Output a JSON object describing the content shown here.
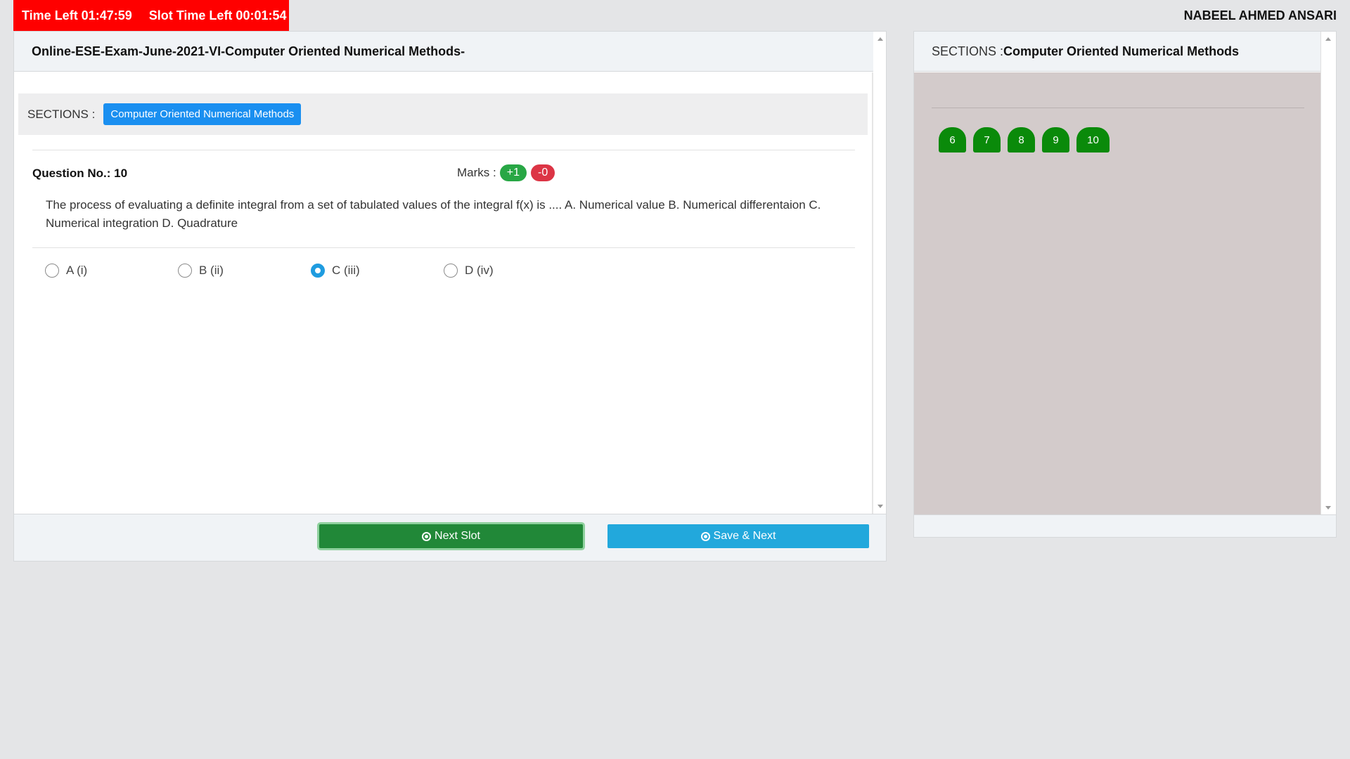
{
  "timer": {
    "time_left": "Time Left 01:47:59",
    "slot_time_left": "Slot Time Left 00:01:54"
  },
  "user": {
    "name": "NABEEL AHMED ANSARI"
  },
  "exam": {
    "title": "Online-ESE-Exam-June-2021-VI-Computer Oriented Numerical Methods-",
    "sections_label": "SECTIONS :",
    "section_name": "Computer Oriented Numerical Methods"
  },
  "question": {
    "number_label": "Question No.: 10",
    "marks_label": "Marks :",
    "marks_positive": "+1",
    "marks_negative": "-0",
    "text": "The process of evaluating a definite integral from a set of tabulated values of the integral f(x) is .... A. Numerical value B. Numerical differentaion C. Numerical integration D. Quadrature",
    "options": [
      {
        "label": "A (i)",
        "checked": false
      },
      {
        "label": "B (ii)",
        "checked": false
      },
      {
        "label": "C (iii)",
        "checked": true
      },
      {
        "label": "D (iv)",
        "checked": false
      }
    ]
  },
  "footer": {
    "next_slot": "Next Slot",
    "save_next": "Save & Next"
  },
  "side": {
    "sections_prefix": "SECTIONS :",
    "section_name": "Computer Oriented Numerical Methods",
    "question_buttons": [
      "6",
      "7",
      "8",
      "9",
      "10"
    ]
  },
  "colors": {
    "timer_bg": "#ff0000",
    "section_chip": "#1a8ff0",
    "answered": "#0a8a0a",
    "save_button": "#22a8dc",
    "next_slot_button": "#218838"
  }
}
